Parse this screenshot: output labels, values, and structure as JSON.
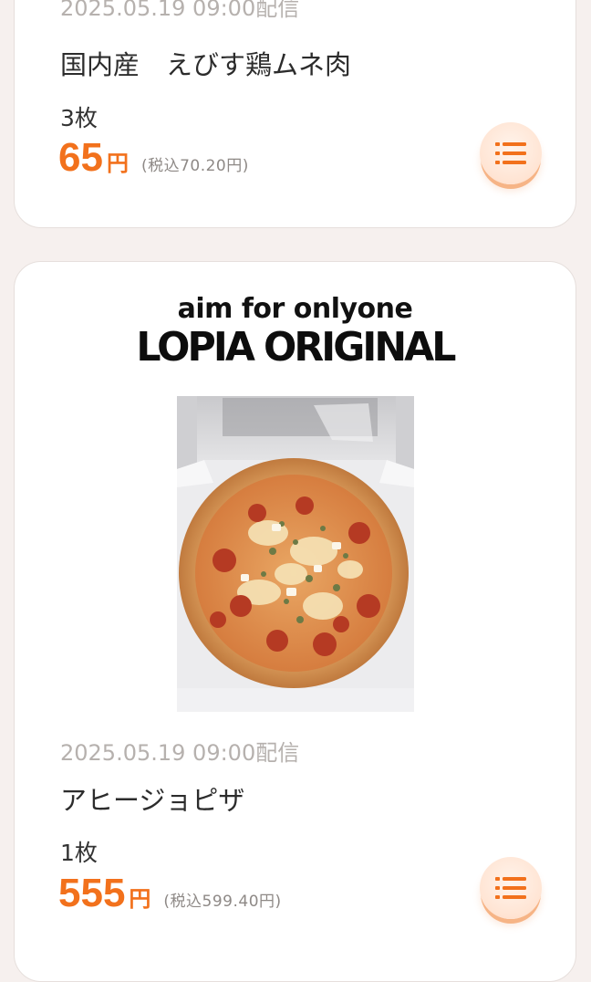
{
  "items": [
    {
      "date": "2025.05.19 09:00配信",
      "name": "国内産　えびす鶏ムネ肉",
      "quantity": "3枚",
      "price": "65",
      "yen": "円",
      "tax_price": "(税込70.20円)",
      "list_icon": "list-icon"
    },
    {
      "banner_line1": "aim for onlyone",
      "banner_line2": "LOPIA ORIGINAL",
      "image_icon": "pizza-photo",
      "date": "2025.05.19 09:00配信",
      "name": "アヒージョピザ",
      "quantity": "1枚",
      "price": "555",
      "yen": "円",
      "tax_price": "(税込599.40円)",
      "list_icon": "list-icon"
    }
  ],
  "colors": {
    "accent": "#f2711c",
    "background": "#f6f0ee",
    "card": "#ffffff",
    "muted_text": "#b6b1ae"
  }
}
